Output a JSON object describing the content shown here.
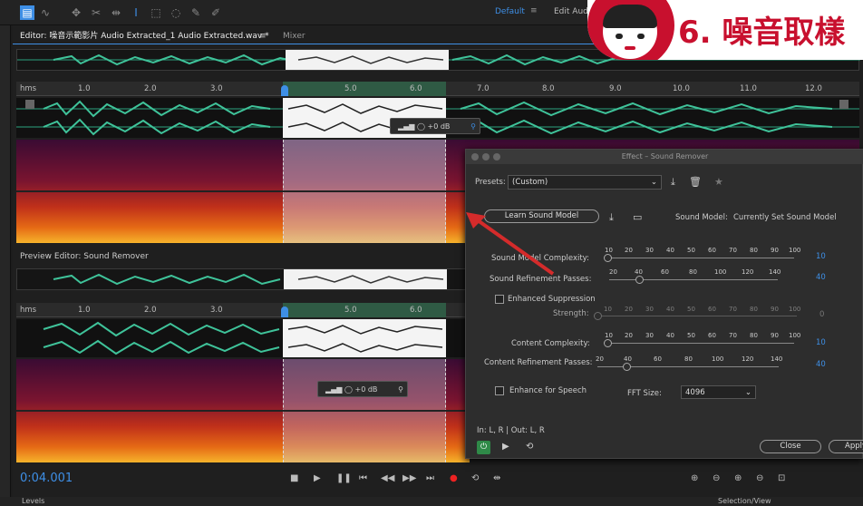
{
  "toolbar": {
    "workspace": "Default",
    "workspace_next": "Edit Audio"
  },
  "editor": {
    "tab_title": "Editor: 噪音示範影片 Audio Extracted_1 Audio Extracted.wav *",
    "mixer_tab": "Mixer",
    "ruler_unit": "hms",
    "ruler_ticks": [
      "1.0",
      "2.0",
      "3.0",
      "5.0",
      "6.0",
      "7.0",
      "8.0",
      "9.0",
      "10.0",
      "11.0",
      "12.0"
    ],
    "gain_value": "+0 dB"
  },
  "preview": {
    "title": "Preview Editor: Sound Remover",
    "ruler_unit": "hms",
    "ruler_ticks": [
      "1.0",
      "2.0",
      "3.0",
      "5.0",
      "6.0"
    ],
    "gain_value": "+0 dB"
  },
  "effect": {
    "window_title": "Effect – Sound Remover",
    "presets_label": "Presets:",
    "presets_value": "(Custom)",
    "learn_button": "Learn Sound Model",
    "sound_model_label": "Sound Model:",
    "sound_model_value": "Currently Set Sound Model",
    "complexity_label": "Sound Model Complexity:",
    "complexity_value": "10",
    "complexity_ticks": [
      "10",
      "20",
      "30",
      "40",
      "50",
      "60",
      "70",
      "80",
      "90",
      "100"
    ],
    "refinement_label": "Sound Refinement Passes:",
    "refinement_value": "40",
    "refinement_ticks": [
      "20",
      "40",
      "60",
      "80",
      "100",
      "120",
      "140"
    ],
    "enhanced_suppression": "Enhanced Suppression",
    "strength_label": "Strength:",
    "strength_value": "0",
    "strength_ticks": [
      "10",
      "20",
      "30",
      "40",
      "50",
      "60",
      "70",
      "80",
      "90",
      "100"
    ],
    "content_complexity_label": "Content Complexity:",
    "content_complexity_value": "10",
    "content_complexity_ticks": [
      "10",
      "20",
      "30",
      "40",
      "50",
      "60",
      "70",
      "80",
      "90",
      "100"
    ],
    "content_refinement_label": "Content Refinement Passes:",
    "content_refinement_value": "40",
    "content_refinement_ticks": [
      "20",
      "40",
      "60",
      "80",
      "100",
      "120",
      "140"
    ],
    "enhance_speech": "Enhance for Speech",
    "fft_label": "FFT Size:",
    "fft_value": "4096",
    "io_label": "In: L, R | Out: L, R",
    "close_button": "Close",
    "apply_button": "Apply"
  },
  "transport": {
    "time": "0:04.001"
  },
  "bottom": {
    "levels": "Levels",
    "selection_view": "Selection/View"
  },
  "overlay": {
    "logo_text": "6. 噪音取樣"
  },
  "colors": {
    "accent_blue": "#3e8fe6",
    "waveform_green": "#3fc39a",
    "logo_red": "#c8102e"
  }
}
